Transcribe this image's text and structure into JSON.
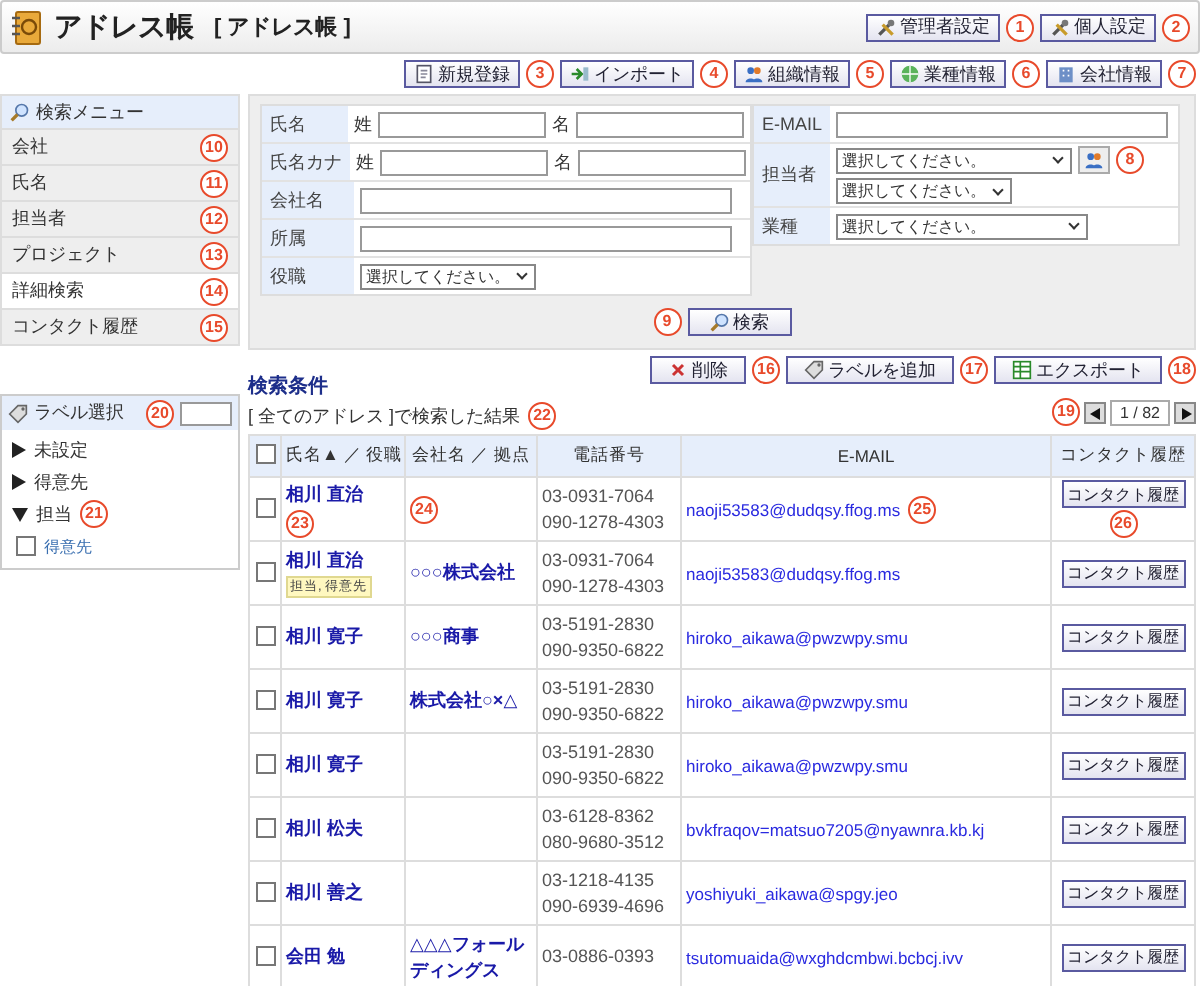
{
  "header": {
    "title": "アドレス帳",
    "subtitle": "[ アドレス帳 ]",
    "buttons": [
      {
        "label": "管理者設定",
        "callout": "1"
      },
      {
        "label": "個人設定",
        "callout": "2"
      }
    ]
  },
  "toolbar": [
    {
      "label": "新規登録",
      "callout": "3"
    },
    {
      "label": "インポート",
      "callout": "4"
    },
    {
      "label": "組織情報",
      "callout": "5"
    },
    {
      "label": "業種情報",
      "callout": "6"
    },
    {
      "label": "会社情報",
      "callout": "7"
    }
  ],
  "search_menu": {
    "title": "検索メニュー",
    "items": [
      {
        "label": "会社",
        "selected": false,
        "callout": "10"
      },
      {
        "label": "氏名",
        "selected": false,
        "callout": "11"
      },
      {
        "label": "担当者",
        "selected": false,
        "callout": "12"
      },
      {
        "label": "プロジェクト",
        "selected": false,
        "callout": "13"
      },
      {
        "label": "詳細検索",
        "selected": true,
        "callout": "14"
      },
      {
        "label": "コンタクト履歴",
        "selected": false,
        "callout": "15"
      }
    ]
  },
  "label_panel": {
    "title": "ラベル選択",
    "callout": "20",
    "tree": [
      {
        "label": "未設定",
        "expanded": false
      },
      {
        "label": "得意先",
        "expanded": false
      },
      {
        "label": "担当",
        "expanded": true,
        "callout": "21",
        "children": [
          {
            "label": "得意先",
            "checked": false
          }
        ]
      }
    ]
  },
  "search_form": {
    "left": [
      {
        "label": "氏名",
        "kind": "split",
        "fields": [
          {
            "prefix": "姓"
          },
          {
            "prefix": "名"
          }
        ]
      },
      {
        "label": "氏名カナ",
        "kind": "split",
        "fields": [
          {
            "prefix": "姓"
          },
          {
            "prefix": "名"
          }
        ]
      },
      {
        "label": "会社名",
        "kind": "text"
      },
      {
        "label": "所属",
        "kind": "text"
      },
      {
        "label": "役職",
        "kind": "select",
        "values": [
          "選択してください。"
        ]
      }
    ],
    "right": [
      {
        "label": "E-MAIL",
        "kind": "text"
      },
      {
        "label": "担当者",
        "kind": "select",
        "values": [
          "選択してください。",
          "選択してください。"
        ],
        "picker": true,
        "callout": "8"
      },
      {
        "label": "業種",
        "kind": "select",
        "values": [
          "選択してください。"
        ]
      }
    ],
    "search_button": "検索",
    "search_callout": "9"
  },
  "results": {
    "title": "検索条件",
    "summary": "[ 全てのアドレス ]で検索した結果",
    "summary_callout": "22",
    "actions": [
      {
        "label": "削除",
        "callout": "16"
      },
      {
        "label": "ラベルを追加",
        "callout": "17"
      },
      {
        "label": "エクスポート",
        "callout": "18"
      }
    ],
    "pager": {
      "page": "1 / 82",
      "callout": "19"
    },
    "columns": [
      {
        "kind": "check",
        "checked": false
      },
      {
        "label": "氏名▲ ／ 役職",
        "kind": "text"
      },
      {
        "label": "会社名 ／ 拠点",
        "kind": "text"
      },
      {
        "label": "電話番号",
        "kind": "text"
      },
      {
        "label": "E-MAIL",
        "kind": "text"
      },
      {
        "label": "コンタクト履歴",
        "kind": "text"
      }
    ],
    "rows": [
      {
        "checked": false,
        "name": "相川 直治",
        "phones": [
          "03-0931-7064",
          "090-1278-4303"
        ],
        "email": "naoji53583@dudqsy.ffog.ms",
        "history": "コンタクト履歴",
        "callouts": {
          "name": "23",
          "company": "24",
          "email": "25",
          "history": "26"
        }
      },
      {
        "checked": false,
        "name": "相川 直治",
        "tag": "担当, 得意先",
        "company": "○○○株式会社",
        "phones": [
          "03-0931-7064",
          "090-1278-4303"
        ],
        "email": "naoji53583@dudqsy.ffog.ms",
        "history": "コンタクト履歴"
      },
      {
        "checked": false,
        "name": "相川 寛子",
        "company": "○○○商事",
        "phones": [
          "03-5191-2830",
          "090-9350-6822"
        ],
        "email": "hiroko_aikawa@pwzwpy.smu",
        "history": "コンタクト履歴"
      },
      {
        "checked": false,
        "name": "相川 寛子",
        "company": "株式会社○×△",
        "phones": [
          "03-5191-2830",
          "090-9350-6822"
        ],
        "email": "hiroko_aikawa@pwzwpy.smu",
        "history": "コンタクト履歴"
      },
      {
        "checked": false,
        "name": "相川 寛子",
        "phones": [
          "03-5191-2830",
          "090-9350-6822"
        ],
        "email": "hiroko_aikawa@pwzwpy.smu",
        "history": "コンタクト履歴"
      },
      {
        "checked": false,
        "name": "相川 松夫",
        "phones": [
          "03-6128-8362",
          "080-9680-3512"
        ],
        "email": "bvkfraqov=matsuo7205@nyawnra.kb.kj",
        "history": "コンタクト履歴"
      },
      {
        "checked": false,
        "name": "相川 善之",
        "phones": [
          "03-1218-4135",
          "090-6939-4696"
        ],
        "email": "yoshiyuki_aikawa@spgy.jeo",
        "history": "コンタクト履歴"
      },
      {
        "checked": false,
        "name": "会田 勉",
        "company": "△△△フォールディングス",
        "phones": [
          "03-0886-0393"
        ],
        "email": "tsutomuaida@wxghdcmbwi.bcbcj.ivv",
        "history": "コンタクト履歴"
      }
    ]
  }
}
